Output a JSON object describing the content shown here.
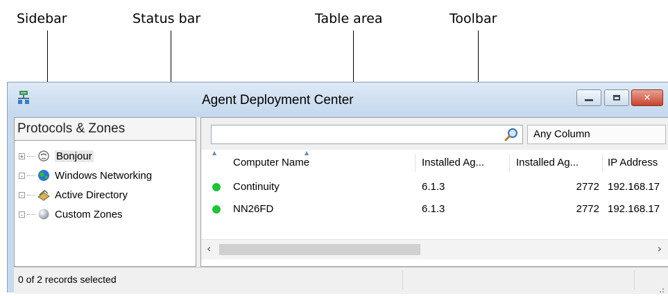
{
  "callouts": {
    "sidebar": "Sidebar",
    "status_bar": "Status bar",
    "table_area": "Table area",
    "toolbar": "Toolbar"
  },
  "window": {
    "title": "Agent Deployment Center",
    "app_icon": "network-computers-icon",
    "controls": {
      "minimize": "minimize-icon",
      "maximize": "maximize-icon",
      "close": "close-icon"
    }
  },
  "sidebar": {
    "header": "Protocols & Zones",
    "items": [
      {
        "label": "Bonjour",
        "icon": "bonjour-icon",
        "expander": "+"
      },
      {
        "label": "Windows Networking",
        "icon": "globe-icon",
        "expander": "-"
      },
      {
        "label": "Active Directory",
        "icon": "directory-book-icon",
        "expander": "-"
      },
      {
        "label": "Custom Zones",
        "icon": "sphere-icon",
        "expander": "-"
      }
    ]
  },
  "toolbar": {
    "search_value": "",
    "search_icon": "magnifier-icon",
    "column_filter": "Any Column"
  },
  "table": {
    "columns": [
      "Computer Name",
      "Installed Ag...",
      "Installed Ag...",
      "IP Address"
    ],
    "rows": [
      {
        "status_color": "#1fc23a",
        "name": "Continuity",
        "agent_version": "6.1.3",
        "agent_build": "2772",
        "ip": "192.168.17"
      },
      {
        "status_color": "#1fc23a",
        "name": "NN26FD",
        "agent_version": "6.1.3",
        "agent_build": "2772",
        "ip": "192.168.17"
      }
    ]
  },
  "status": {
    "text": "0 of 2 records selected"
  }
}
